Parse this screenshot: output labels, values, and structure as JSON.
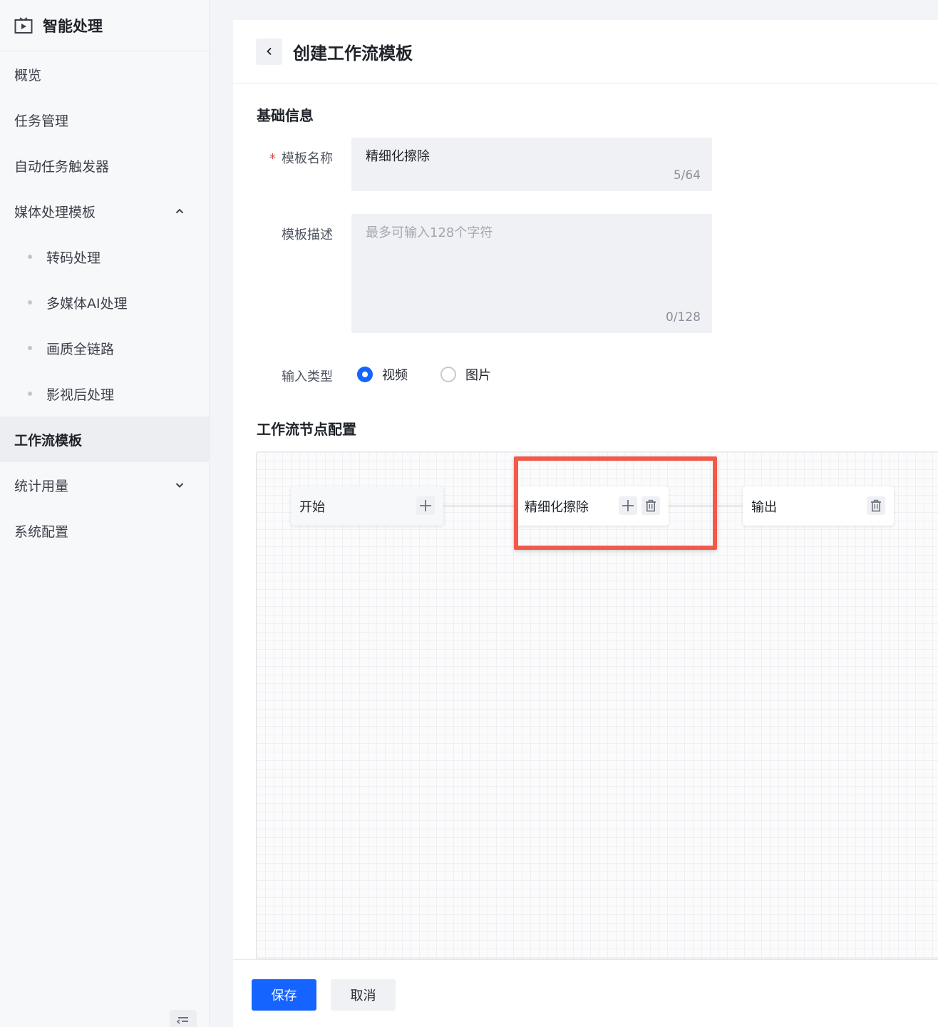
{
  "sidebar": {
    "title": "智能处理",
    "items": [
      {
        "label": "概览"
      },
      {
        "label": "任务管理"
      },
      {
        "label": "自动任务触发器"
      },
      {
        "label": "媒体处理模板",
        "expanded": true
      },
      {
        "label": "转码处理"
      },
      {
        "label": "多媒体AI处理"
      },
      {
        "label": "画质全链路"
      },
      {
        "label": "影视后处理"
      },
      {
        "label": "工作流模板",
        "active": true
      },
      {
        "label": "统计用量"
      },
      {
        "label": "系统配置"
      }
    ]
  },
  "page": {
    "title": "创建工作流模板"
  },
  "basic": {
    "section_title": "基础信息",
    "name_label": "模板名称",
    "name_required_mark": "*",
    "name_value": "精细化擦除",
    "name_count": "5/64",
    "desc_label": "模板描述",
    "desc_placeholder": "最多可输入128个字符",
    "desc_count": "0/128",
    "input_type_label": "输入类型",
    "input_types": [
      {
        "label": "视频",
        "checked": true
      },
      {
        "label": "图片",
        "checked": false
      }
    ]
  },
  "workflow": {
    "section_title": "工作流节点配置",
    "nodes": [
      {
        "label": "开始"
      },
      {
        "label": "精细化擦除"
      },
      {
        "label": "输出"
      }
    ]
  },
  "footer": {
    "save_label": "保存",
    "cancel_label": "取消"
  },
  "colors": {
    "primary": "#1664ff",
    "highlight": "#f15a4a"
  }
}
